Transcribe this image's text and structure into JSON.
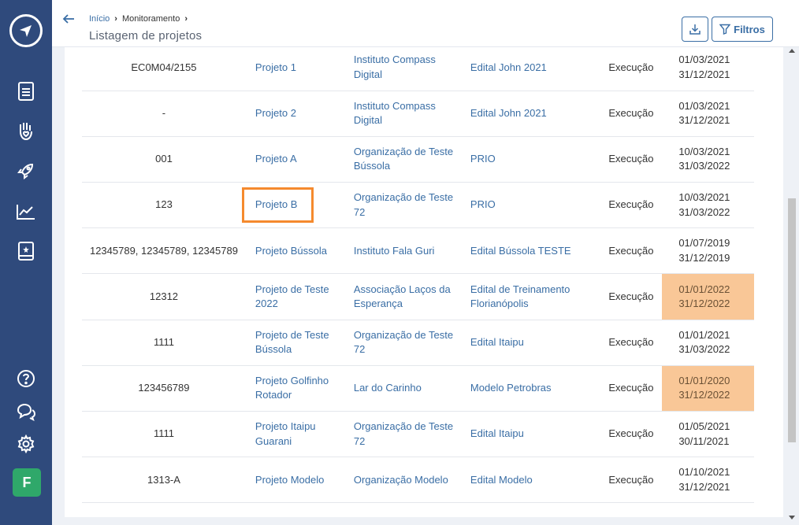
{
  "sidebar": {
    "icons": [
      "logo-icon",
      "document-icon",
      "hand-heart-icon",
      "rocket-icon",
      "chart-icon",
      "book-icon",
      "help-icon",
      "chat-icon",
      "gear-icon"
    ],
    "avatar_letter": "F"
  },
  "header": {
    "breadcrumb": {
      "home": "Início",
      "current": "Monitoramento"
    },
    "title": "Listagem de projetos",
    "filter_label": "Filtros"
  },
  "colors": {
    "accent": "#3a6ea5",
    "sidebar": "#2f4a7c",
    "highlight": "#f9c797",
    "selection": "#f58a2e"
  },
  "rows": [
    {
      "code": "EC0M04/2155",
      "project": "Projeto 1",
      "org": "Instituto Compass Digital",
      "edital": "Edital John 2021",
      "status": "Execução",
      "start": "01/03/2021",
      "end": "31/12/2021",
      "highlight": false
    },
    {
      "code": "-",
      "project": "Projeto 2",
      "org": "Instituto Compass Digital",
      "edital": "Edital John 2021",
      "status": "Execução",
      "start": "01/03/2021",
      "end": "31/12/2021",
      "highlight": false
    },
    {
      "code": "001",
      "project": "Projeto A",
      "org": "Organização de Teste Bússola",
      "edital": "PRIO",
      "status": "Execução",
      "start": "10/03/2021",
      "end": "31/03/2022",
      "highlight": false
    },
    {
      "code": "123",
      "project": "Projeto B",
      "org": "Organização de Teste 72",
      "edital": "PRIO",
      "status": "Execução",
      "start": "10/03/2021",
      "end": "31/03/2022",
      "highlight": false
    },
    {
      "code": "12345789, 12345789, 12345789",
      "project": "Projeto Bússola",
      "org": "Instituto Fala Guri",
      "edital": "Edital Bússola TESTE",
      "status": "Execução",
      "start": "01/07/2019",
      "end": "31/12/2019",
      "highlight": false
    },
    {
      "code": "12312",
      "project": "Projeto de Teste 2022",
      "org": "Associação Laços da Esperança",
      "edital": "Edital de Treinamento Florianópolis",
      "status": "Execução",
      "start": "01/01/2022",
      "end": "31/12/2022",
      "highlight": true
    },
    {
      "code": "1111",
      "project": "Projeto de Teste Bússola",
      "org": "Organização de Teste 72",
      "edital": "Edital Itaipu",
      "status": "Execução",
      "start": "01/01/2021",
      "end": "31/03/2022",
      "highlight": false
    },
    {
      "code": "123456789",
      "project": "Projeto Golfinho Rotador",
      "org": "Lar do Carinho",
      "edital": "Modelo Petrobras",
      "status": "Execução",
      "start": "01/01/2020",
      "end": "31/12/2022",
      "highlight": true
    },
    {
      "code": "1111",
      "project": "Projeto Itaipu Guarani",
      "org": "Organização de Teste 72",
      "edital": "Edital Itaipu",
      "status": "Execução",
      "start": "01/05/2021",
      "end": "30/11/2021",
      "highlight": false
    },
    {
      "code": "1313-A",
      "project": "Projeto Modelo",
      "org": "Organização Modelo",
      "edital": "Edital Modelo",
      "status": "Execução",
      "start": "01/10/2021",
      "end": "31/12/2021",
      "highlight": false
    }
  ]
}
